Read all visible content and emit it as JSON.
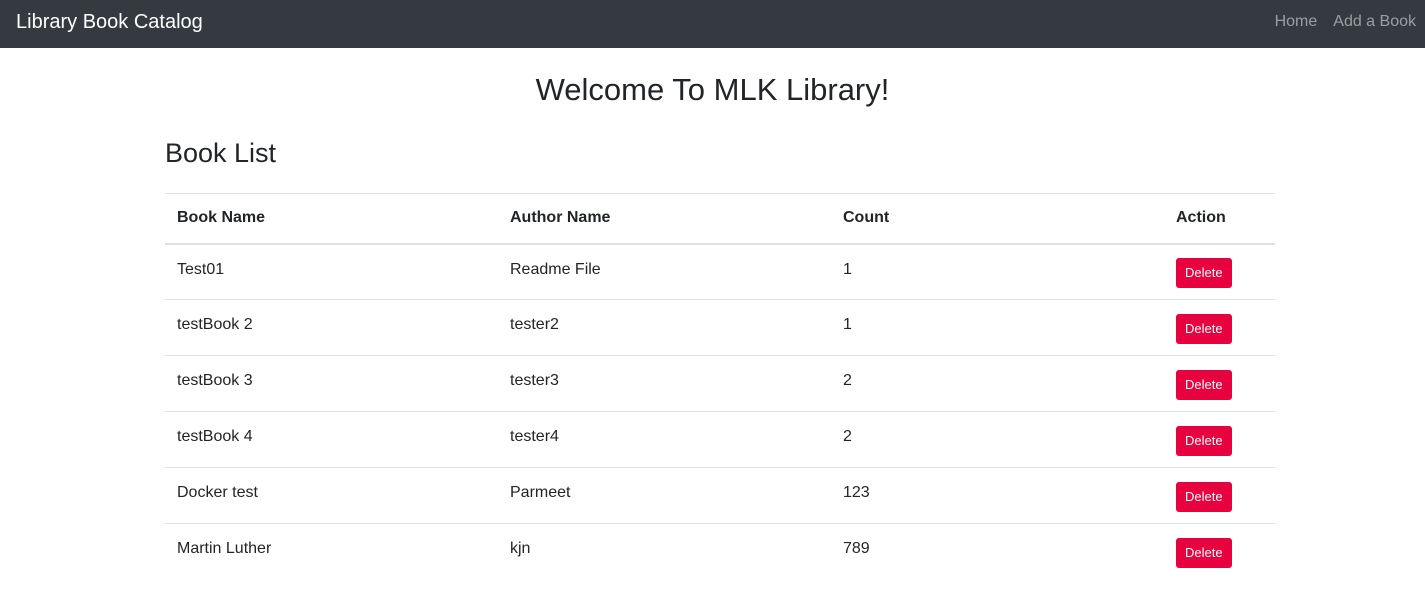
{
  "navbar": {
    "brand": "Library Book Catalog",
    "links": [
      "Home",
      "Add a Book"
    ]
  },
  "welcome": "Welcome To MLK Library!",
  "book_list": {
    "title": "Book List",
    "columns": [
      "Book Name",
      "Author Name",
      "Count",
      "Action"
    ],
    "rows": [
      {
        "book": "Test01",
        "author": "Readme File",
        "count": "1",
        "action": "Delete"
      },
      {
        "book": "testBook 2",
        "author": "tester2",
        "count": "1",
        "action": "Delete"
      },
      {
        "book": "testBook 3",
        "author": "tester3",
        "count": "2",
        "action": "Delete"
      },
      {
        "book": "testBook 4",
        "author": "tester4",
        "count": "2",
        "action": "Delete"
      },
      {
        "book": "Docker test",
        "author": "Parmeet",
        "count": "123",
        "action": "Delete"
      },
      {
        "book": "Martin Luther",
        "author": "kjn",
        "count": "789",
        "action": "Delete"
      }
    ]
  },
  "colors": {
    "navbar_bg": "#343a40",
    "delete_button": "#e9003f"
  }
}
